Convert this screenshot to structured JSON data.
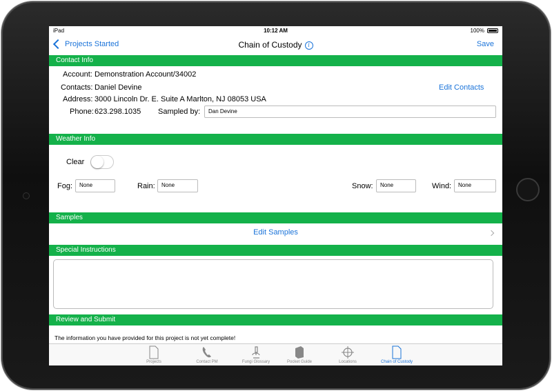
{
  "status": {
    "carrier": "iPad",
    "time": "10:12 AM",
    "battery": "100%"
  },
  "nav": {
    "back_label": "Projects Started",
    "title": "Chain of Custody",
    "save_label": "Save"
  },
  "contact": {
    "header": "Contact Info",
    "account_label": "Account:",
    "account_value": "Demonstration Account/34002",
    "contacts_label": "Contacts:",
    "contacts_value": "Daniel Devine",
    "edit_contacts": "Edit Contacts",
    "address_label": "Address:",
    "address_value": "3000 Lincoln Dr. E. Suite A Marlton, NJ  08053 USA",
    "phone_label": "Phone:",
    "phone_value": "623.298.1035",
    "sampled_label": "Sampled by:",
    "sampled_value": "Dan Devine"
  },
  "weather": {
    "header": "Weather Info",
    "clear_label": "Clear",
    "clear_on": false,
    "fog_label": "Fog:",
    "fog_value": "None",
    "rain_label": "Rain:",
    "rain_value": "None",
    "snow_label": "Snow:",
    "snow_value": "None",
    "wind_label": "Wind:",
    "wind_value": "None"
  },
  "samples": {
    "header": "Samples",
    "edit_label": "Edit Samples"
  },
  "special": {
    "header": "Special Instructions",
    "value": ""
  },
  "review": {
    "header": "Review and Submit",
    "notice": "The information you have provided for this project is not yet complete!"
  },
  "tabs": [
    {
      "label": "Projects",
      "icon": "document-icon"
    },
    {
      "label": "Contact PM",
      "icon": "phone-icon"
    },
    {
      "label": "Fungi Glossary",
      "icon": "microscope-icon"
    },
    {
      "label": "Pocket Guide",
      "icon": "book-icon"
    },
    {
      "label": "Locations",
      "icon": "crosshair-icon"
    },
    {
      "label": "Chain of Custody",
      "icon": "document-icon"
    }
  ],
  "colors": {
    "section_green": "#14b14a",
    "link_blue": "#1a73d9"
  }
}
